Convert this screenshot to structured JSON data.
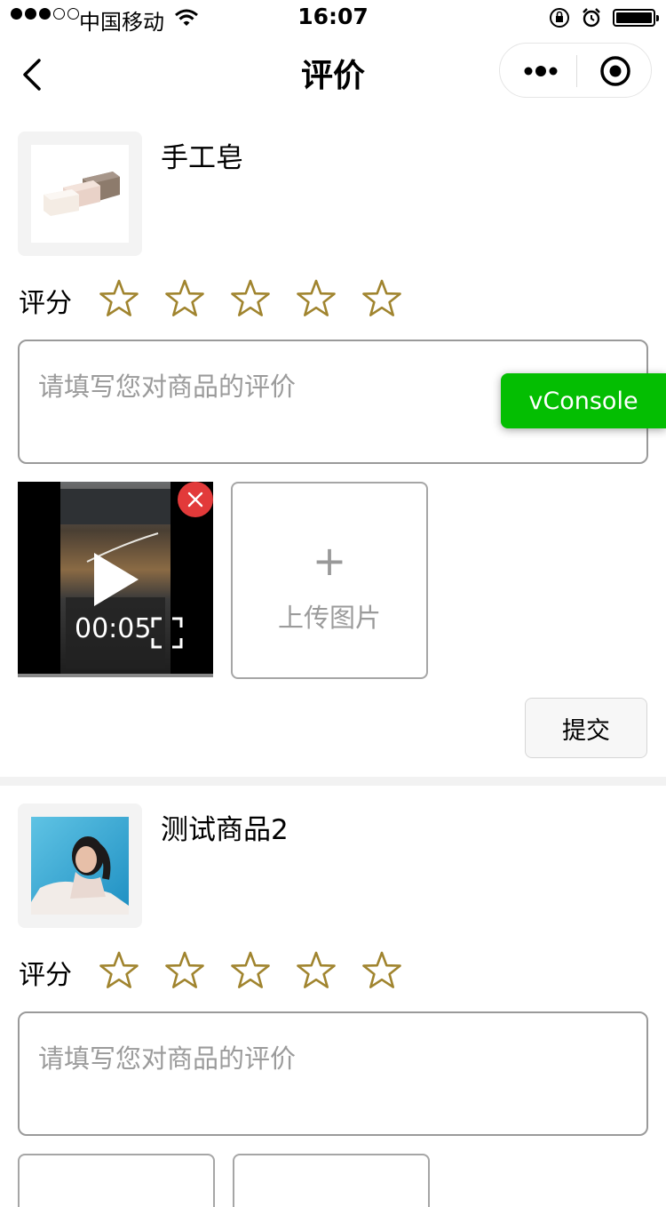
{
  "status_bar": {
    "carrier": "中国移动",
    "time": "16:07",
    "signal_bars_filled": 3,
    "signal_bars_total": 5
  },
  "nav": {
    "title": "评价",
    "back_icon": "chevron-left-icon",
    "more_icon": "more-dots-icon",
    "close_icon": "target-close-icon"
  },
  "products": [
    {
      "name": "手工皂",
      "score_label": "评分",
      "stars": [
        0,
        0,
        0,
        0,
        0
      ],
      "comment_placeholder": "请填写您对商品的评价",
      "video_time": "00:05",
      "upload_label": "上传图片",
      "submit_label": "提交"
    },
    {
      "name": "测试商品2",
      "score_label": "评分",
      "stars": [
        0,
        0,
        0,
        0,
        0
      ],
      "comment_placeholder": "请填写您对商品的评价"
    }
  ],
  "vconsole_label": "vConsole",
  "colors": {
    "star_outline": "#a0842e",
    "delete_badge": "#e23a3a",
    "vconsole_green": "#04be02",
    "border_gray": "#9a9a9a"
  }
}
